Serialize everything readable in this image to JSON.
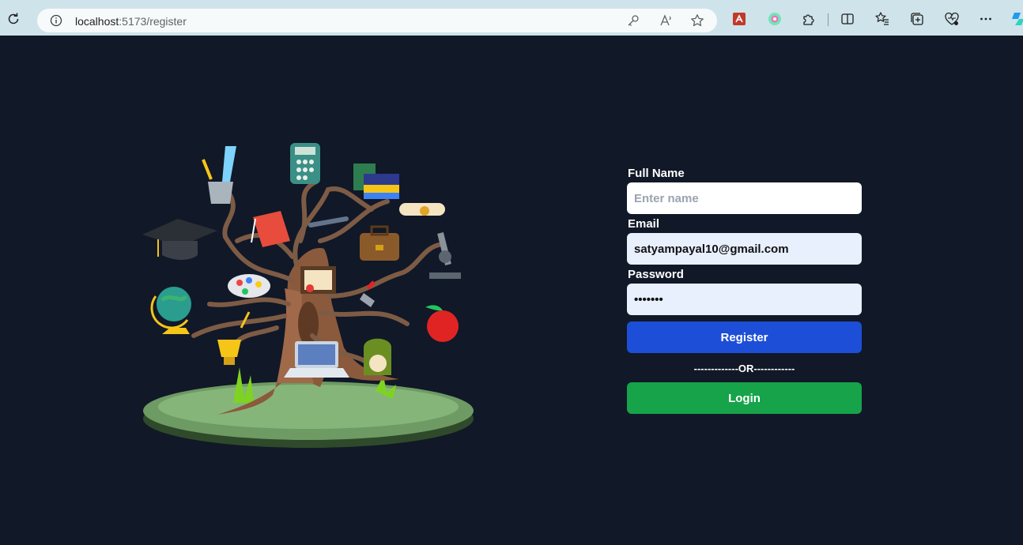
{
  "browser": {
    "url_host": "localhost",
    "url_path": ":5173/register"
  },
  "form": {
    "full_name_label": "Full Name",
    "full_name_placeholder": "Enter name",
    "full_name_value": "",
    "email_label": "Email",
    "email_value": "satyampayal10@gmail.com",
    "password_label": "Password",
    "password_value": "•••••••",
    "register_label": "Register",
    "or_divider": "-------------OR------------",
    "login_label": "Login"
  },
  "colors": {
    "page_background": "#111827",
    "register_button": "#1d4ed8",
    "login_button": "#16a34a",
    "autofill_input": "#e8f0fe"
  }
}
